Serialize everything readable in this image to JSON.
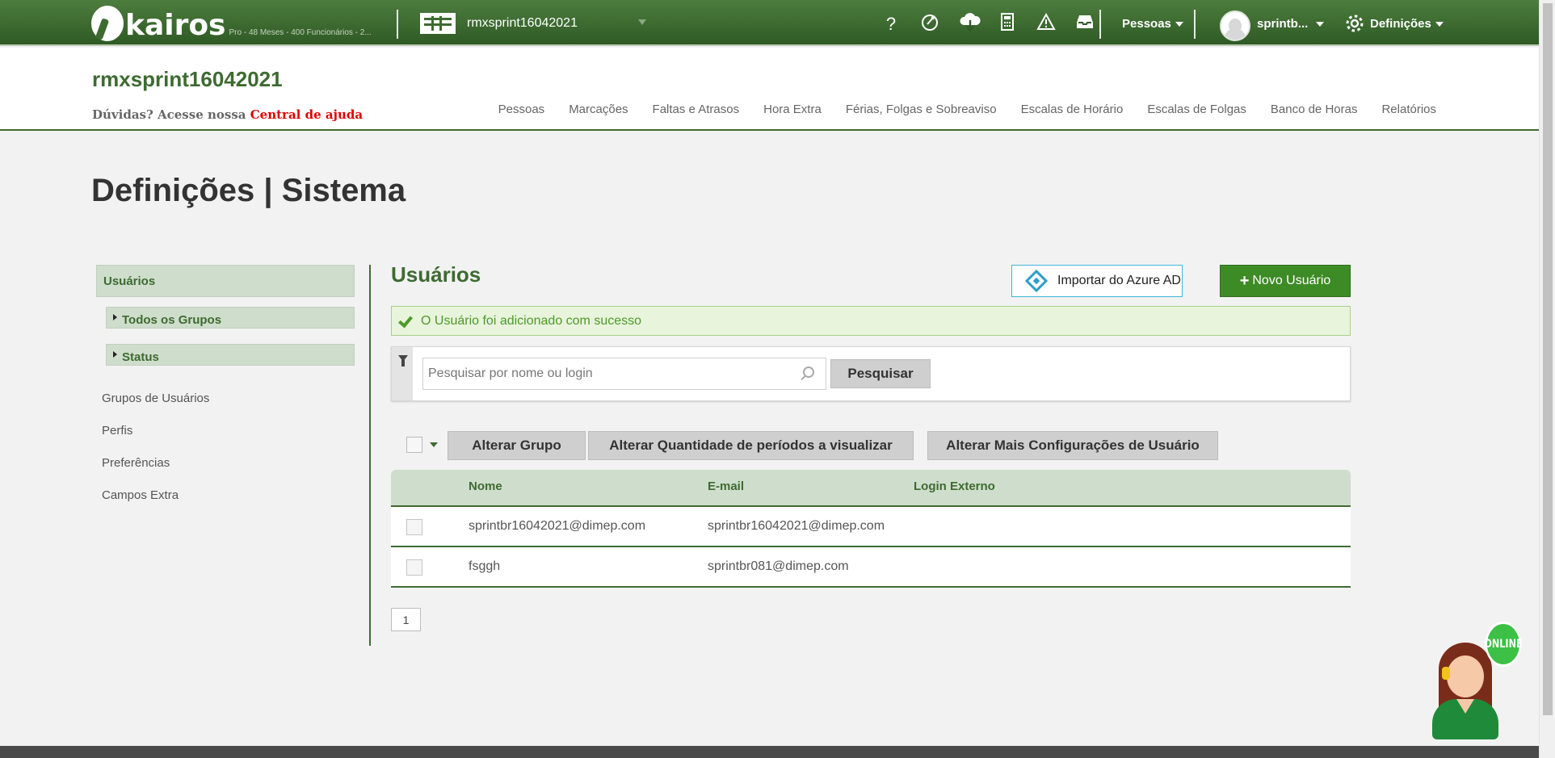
{
  "topbar": {
    "brand": "kairos",
    "plan": "Pro - 48 Meses - 400 Funcionários - 2...",
    "company_selector": "rmxsprint16042021",
    "icons": [
      "help-icon",
      "rocket-icon",
      "cloud-download-icon",
      "calculator-icon",
      "warning-icon",
      "inbox-icon"
    ],
    "help_glyph": "?",
    "people_menu": "Pessoas",
    "user_menu": "sprintb...",
    "settings_menu": "Definições"
  },
  "header": {
    "company_title": "rmxsprint16042021",
    "help_prefix": "Dúvidas? Acesse nossa",
    "help_link": "Central de ajuda",
    "nav": [
      "Pessoas",
      "Marcações",
      "Faltas e Atrasos",
      "Hora Extra",
      "Férias, Folgas e Sobreaviso",
      "Escalas de Horário",
      "Escalas de Folgas",
      "Banco de Horas",
      "Relatórios"
    ]
  },
  "page_title": "Definições | Sistema",
  "sidebar": {
    "active": "Usuários",
    "subs": [
      "Todos os Grupos",
      "Status"
    ],
    "links": [
      "Grupos de Usuários",
      "Perfis",
      "Preferências",
      "Campos Extra"
    ]
  },
  "main": {
    "title": "Usuários",
    "azure_button": "Importar do Azure AD",
    "new_button": "Novo Usuário",
    "new_button_plus": "+",
    "alert": "O Usuário foi adicionado com sucesso",
    "search_placeholder": "Pesquisar por nome ou login",
    "search_button": "Pesquisar",
    "bulk": [
      "Alterar Grupo",
      "Alterar Quantidade de períodos a visualizar",
      "Alterar Mais Configurações de Usuário"
    ],
    "columns": [
      "Nome",
      "E-mail",
      "Login Externo"
    ],
    "rows": [
      {
        "name": "sprintbr16042021@dimep.com",
        "email": "sprintbr16042021@dimep.com",
        "external": ""
      },
      {
        "name": "fsggh",
        "email": "sprintbr081@dimep.com",
        "external": ""
      }
    ],
    "page": "1"
  },
  "chat": {
    "status": "ONLINE"
  },
  "colors": {
    "brand_green": "#3d6b31",
    "button_green": "#3d8b25",
    "alert_text": "#4c9a2a",
    "link_red": "#e00000"
  }
}
